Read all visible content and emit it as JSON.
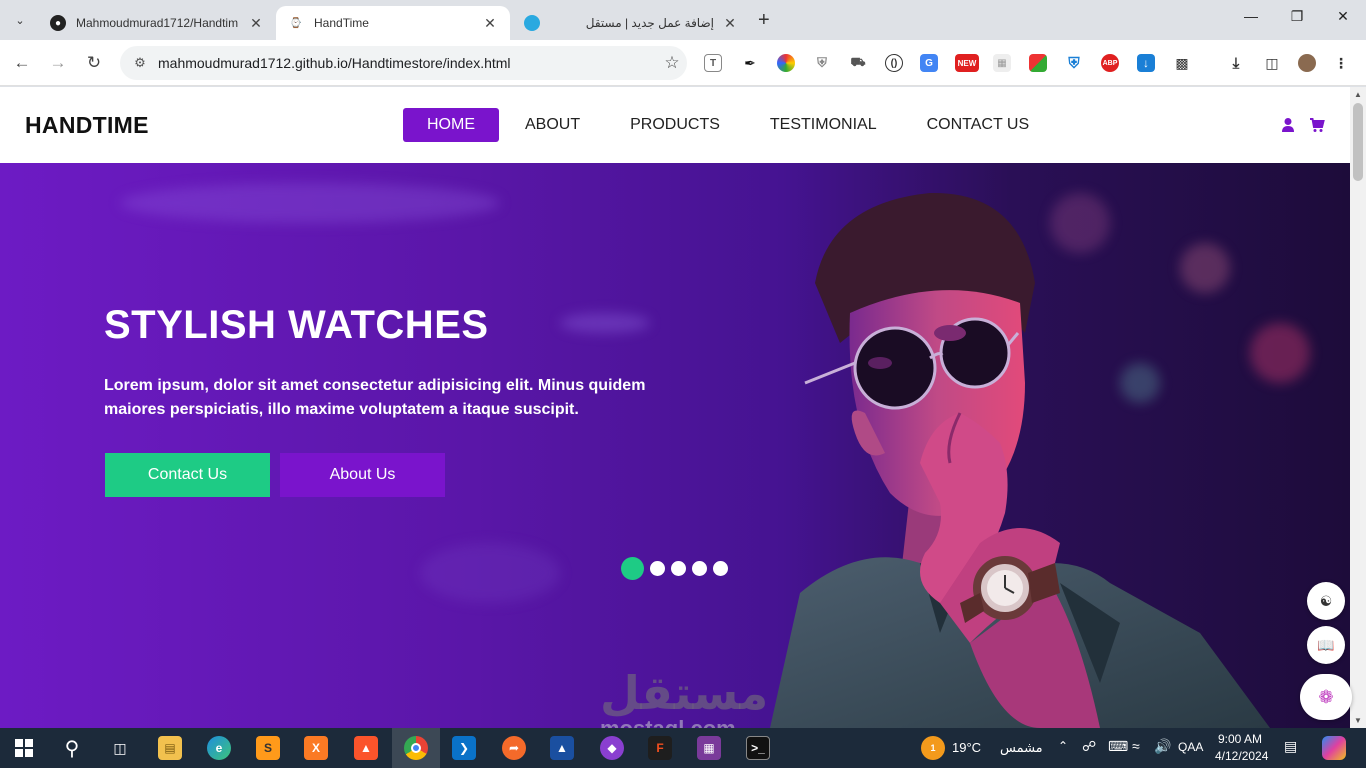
{
  "browser": {
    "tabs": [
      {
        "title": "Mahmoudmurad1712/Handtim",
        "active": false
      },
      {
        "title": "HandTime",
        "active": true
      },
      {
        "title": "إضافة عمل جديد | مستقل",
        "active": false
      }
    ],
    "url": "mahmoudmurad1712.github.io/Handtimestore/index.html"
  },
  "site": {
    "logo": "HANDTIME",
    "menu": [
      "HOME",
      "ABOUT",
      "PRODUCTS",
      "TESTIMONIAL",
      "CONTACT US"
    ],
    "active_menu": "HOME",
    "accent_color": "#7a14cc",
    "green_color": "#1ecb85"
  },
  "hero": {
    "title": "STYLISH WATCHES",
    "text": "Lorem ipsum, dolor sit amet consectetur adipisicing elit. Minus quidem maiores perspiciatis, illo maxime voluptatem a itaque suscipit.",
    "btn_contact": "Contact Us",
    "btn_about": "About Us",
    "slides": 5,
    "active_slide": 1
  },
  "watermark": {
    "arabic": "مستقل",
    "latin": "mostaql.com"
  },
  "taskbar": {
    "temperature": "19°C",
    "weather_label": "مشمس",
    "weather_badge": "1",
    "lang": "QAA",
    "time": "9:00 AM",
    "date": "4/12/2024"
  }
}
